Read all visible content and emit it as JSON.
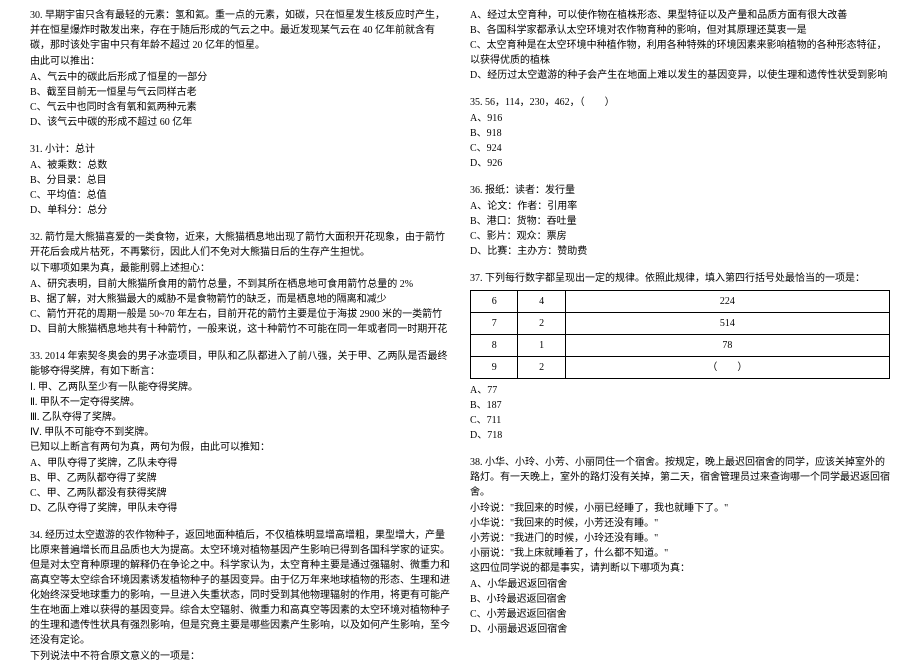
{
  "left": {
    "q30": {
      "stem": "30. 早期宇宙只含有最轻的元素：氢和氦。重一点的元素，如碳，只在恒星发生核反应时产生，并在恒星爆炸时散发出来，存在于随后形成的气云之中。最近发现某气云在 40 亿年前就含有碳，那时该处宇宙中只有年龄不超过 20 亿年的恒星。",
      "lead": "由此可以推出：",
      "a": "A、气云中的碳此后形成了恒星的一部分",
      "b": "B、截至目前无一恒星与气云同样古老",
      "c": "C、气云中也同时含有氧和氦两种元素",
      "d": "D、该气云中碳的形成不超过 60 亿年"
    },
    "q31": {
      "stem": "31. 小计：总计",
      "a": "A、被乘数：总数",
      "b": "B、分目录：总目",
      "c": "C、平均值：总值",
      "d": "D、单科分：总分"
    },
    "q32": {
      "stem": "32. 箭竹是大熊猫喜爱的一类食物，近来，大熊猫栖息地出现了箭竹大面积开花现象，由于箭竹开花后会成片枯死，不再繁衍，因此人们不免对大熊猫日后的生存产生担忧。",
      "lead": "以下哪项如果为真，最能削弱上述担心：",
      "a": "A、研究表明，目前大熊猫所食用的箭竹总量，不到其所在栖息地可食用箭竹总量的 2%",
      "b": "B、据了解，对大熊猫最大的威胁不是食物箭竹的缺乏，而是栖息地的隔离和减少",
      "c": "C、箭竹开花的周期一般是 50~70 年左右，目前开花的箭竹主要是位于海拔 2900 米的一类箭竹",
      "d": "D、目前大熊猫栖息地共有十种箭竹，一般来说，这十种箭竹不可能在同一年或者同一时期开花"
    },
    "q33": {
      "stem": "33. 2014 年索契冬奥会的男子冰壶项目，甲队和乙队都进入了前八强，关于甲、乙两队是否最终能够夺得奖牌，有如下断言：",
      "s1": "Ⅰ. 甲、乙两队至少有一队能夺得奖牌。",
      "s2": "Ⅱ. 甲队不一定夺得奖牌。",
      "s3": "Ⅲ. 乙队夺得了奖牌。",
      "s4": "Ⅳ. 甲队不可能夺不到奖牌。",
      "lead": "已知以上断言有两句为真，两句为假，由此可以推知：",
      "a": "A、甲队夺得了奖牌，乙队未夺得",
      "b": "B、甲、乙两队都夺得了奖牌",
      "c": "C、甲、乙两队都没有获得奖牌",
      "d": "D、乙队夺得了奖牌，甲队未夺得"
    },
    "q34": {
      "stem": "34. 经历过太空遨游的农作物种子，返回地面种植后，不仅植株明显增高增粗，果型增大，产量比原来普遍增长而且品质也大为提高。太空环境对植物基因产生影响已得到各国科学家的证实。但是对太空育种原理的解释仍在争论之中。科学家认为，太空育种主要是通过强辐射、微重力和高真空等太空综合环境因素诱发植物种子的基因变异。由于亿万年来地球植物的形态、生理和进化始终深受地球重力的影响，一旦进入失重状态，同时受到其他物理辐射的作用，将更有可能产生在地面上难以获得的基因变异。综合太空辐射、微重力和高真空等因素的太空环境对植物种子的生理和遗传性状具有强烈影响，但是究竟主要是哪些因素产生影响，以及如何产生影响，至今还没有定论。",
      "lead": "下列说法中不符合原文意义的一项是："
    }
  },
  "right": {
    "q34cont": {
      "a": "A、经过太空育种，可以使作物在植株形态、果型特征以及产量和品质方面有很大改善",
      "b": "B、各国科学家都承认太空环境对农作物育种的影响，但对其原理还莫衷一是",
      "c": "C、太空育种是在太空环境中种植作物，利用各种特殊的环境因素来影响植物的各种形态特征，以获得优质的植株",
      "d": "D、经历过太空遨游的种子会产生在地面上难以发生的基因变异，以使生理和遗传性状受到影响"
    },
    "q35": {
      "stem": "35. 56，114，230，462，（　　）",
      "a": "A、916",
      "b": "B、918",
      "c": "C、924",
      "d": "D、926"
    },
    "q36": {
      "stem": "36. 报纸：读者：发行量",
      "a": "A、论文：作者：引用率",
      "b": "B、港口：货物：吞吐量",
      "c": "C、影片：观众：票房",
      "d": "D、比赛：主办方：赞助费"
    },
    "q37": {
      "stem": "37. 下列每行数字都呈现出一定的规律。依照此规律，填入第四行括号处最恰当的一项是：",
      "table": {
        "r1c1": "6",
        "r1c2": "4",
        "r1c3": "224",
        "r2c1": "7",
        "r2c2": "2",
        "r2c3": "514",
        "r3c1": "8",
        "r3c2": "1",
        "r3c3": "78",
        "r4c1": "9",
        "r4c2": "2",
        "r4c3": "（　　）"
      },
      "a": "A、77",
      "b": "B、187",
      "c": "C、711",
      "d": "D、718"
    },
    "q38": {
      "stem": "38. 小华、小玲、小芳、小丽同住一个宿舍。按规定，晚上最迟回宿舍的同学，应该关掉室外的路灯。有一天晚上，室外的路灯没有关掉，第二天，宿舍管理员过来查询哪一个同学最迟返回宿舍。",
      "l1": "小玲说：\"我回来的时候，小丽已经睡了，我也就睡下了。\"",
      "l2": "小华说：\"我回来的时候，小芳还没有睡。\"",
      "l3": "小芳说：\"我进门的时候，小玲还没有睡。\"",
      "l4": "小丽说：\"我上床就睡着了，什么都不知道。\"",
      "lead": "这四位同学说的都是事实，请判断以下哪项为真：",
      "a": "A、小华最迟返回宿舍",
      "b": "B、小玲最迟返回宿舍",
      "c": "C、小芳最迟返回宿舍",
      "d": "D、小丽最迟返回宿舍"
    }
  }
}
